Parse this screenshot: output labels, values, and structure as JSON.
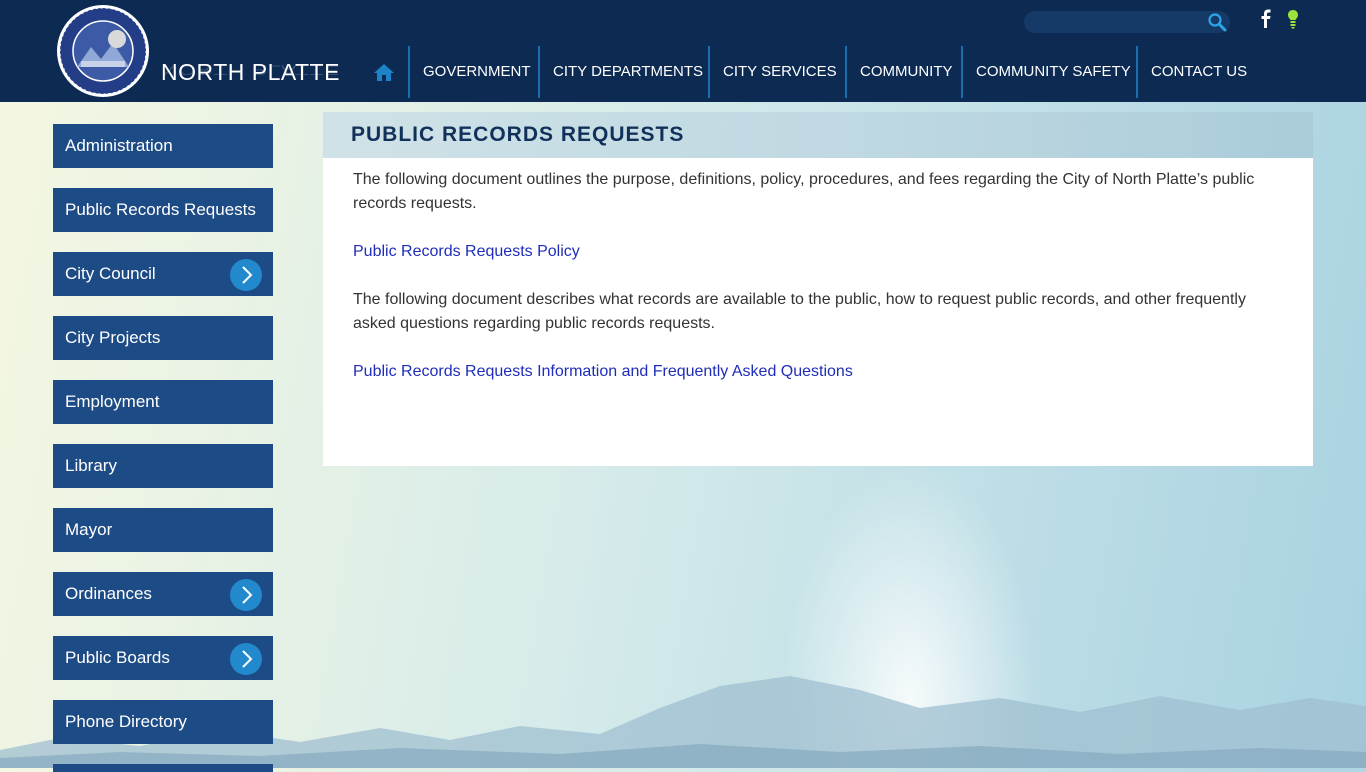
{
  "site": {
    "name": "NORTH PLATTE",
    "logo_alt": "City of North Platte Lincoln Co. Nebraska seal"
  },
  "search": {
    "placeholder": "",
    "value": ""
  },
  "social": {
    "facebook": "f"
  },
  "nav": {
    "home_icon": "home-icon",
    "items": [
      "GOVERNMENT",
      "CITY DEPARTMENTS",
      "CITY SERVICES",
      "COMMUNITY",
      "COMMUNITY SAFETY",
      "CONTACT US"
    ]
  },
  "sidebar": {
    "items": [
      {
        "label": "Administration",
        "has_children": false
      },
      {
        "label": "Public Records Requests",
        "has_children": false
      },
      {
        "label": "City Council",
        "has_children": true
      },
      {
        "label": "City Projects",
        "has_children": false
      },
      {
        "label": "Employment",
        "has_children": false
      },
      {
        "label": "Library",
        "has_children": false
      },
      {
        "label": "Mayor",
        "has_children": false
      },
      {
        "label": "Ordinances",
        "has_children": true
      },
      {
        "label": "Public Boards",
        "has_children": true
      },
      {
        "label": "Phone Directory",
        "has_children": false
      }
    ]
  },
  "page": {
    "title": "PUBLIC RECORDS REQUESTS",
    "para1": "The following document outlines the purpose, definitions, policy, procedures, and fees regarding the City of North Platte’s public records requests.",
    "link1": "Public Records Requests Policy",
    "para2": "The following document describes what records are available to the public, how to request public records, and other frequently asked questions regarding public records requests.",
    "link2": "Public Records Requests Information and Frequently Asked Questions"
  },
  "colors": {
    "header_bg": "#0c2a52",
    "sidebar_bg": "#1d4b86",
    "arrow_bg": "#2289cc",
    "link": "#1f2db8",
    "title": "#12315a"
  }
}
